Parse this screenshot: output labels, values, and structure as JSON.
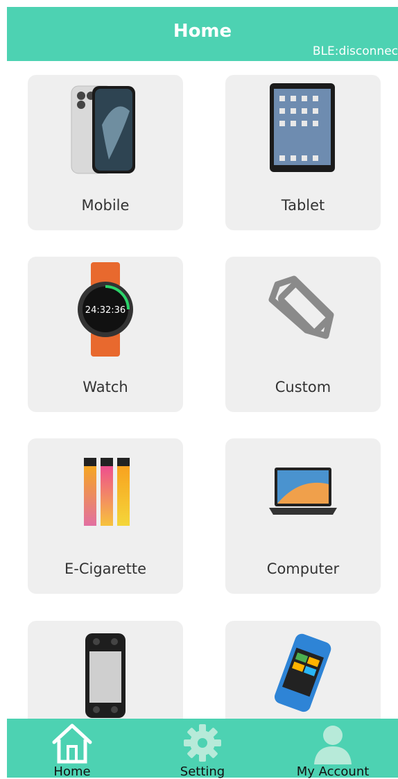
{
  "header": {
    "title": "Home",
    "status": "BLE:disconnec"
  },
  "cards": [
    {
      "label": "Mobile",
      "icon": "phone-icon"
    },
    {
      "label": "Tablet",
      "icon": "tablet-icon"
    },
    {
      "label": "Watch",
      "icon": "watch-icon",
      "watch_time": "24:32:36"
    },
    {
      "label": "Custom",
      "icon": "ruler-pencil-icon"
    },
    {
      "label": "E-Cigarette",
      "icon": "e-cigarette-icon"
    },
    {
      "label": "Computer",
      "icon": "laptop-icon"
    },
    {
      "label": "",
      "icon": "handheld-console-icon"
    },
    {
      "label": "",
      "icon": "pos-terminal-icon"
    }
  ],
  "tabs": [
    {
      "label": "Home",
      "icon": "home-icon"
    },
    {
      "label": "Setting",
      "icon": "gear-icon"
    },
    {
      "label": "My Account",
      "icon": "user-icon"
    }
  ],
  "colors": {
    "accent": "#4dd2b2",
    "card": "#efefef"
  }
}
